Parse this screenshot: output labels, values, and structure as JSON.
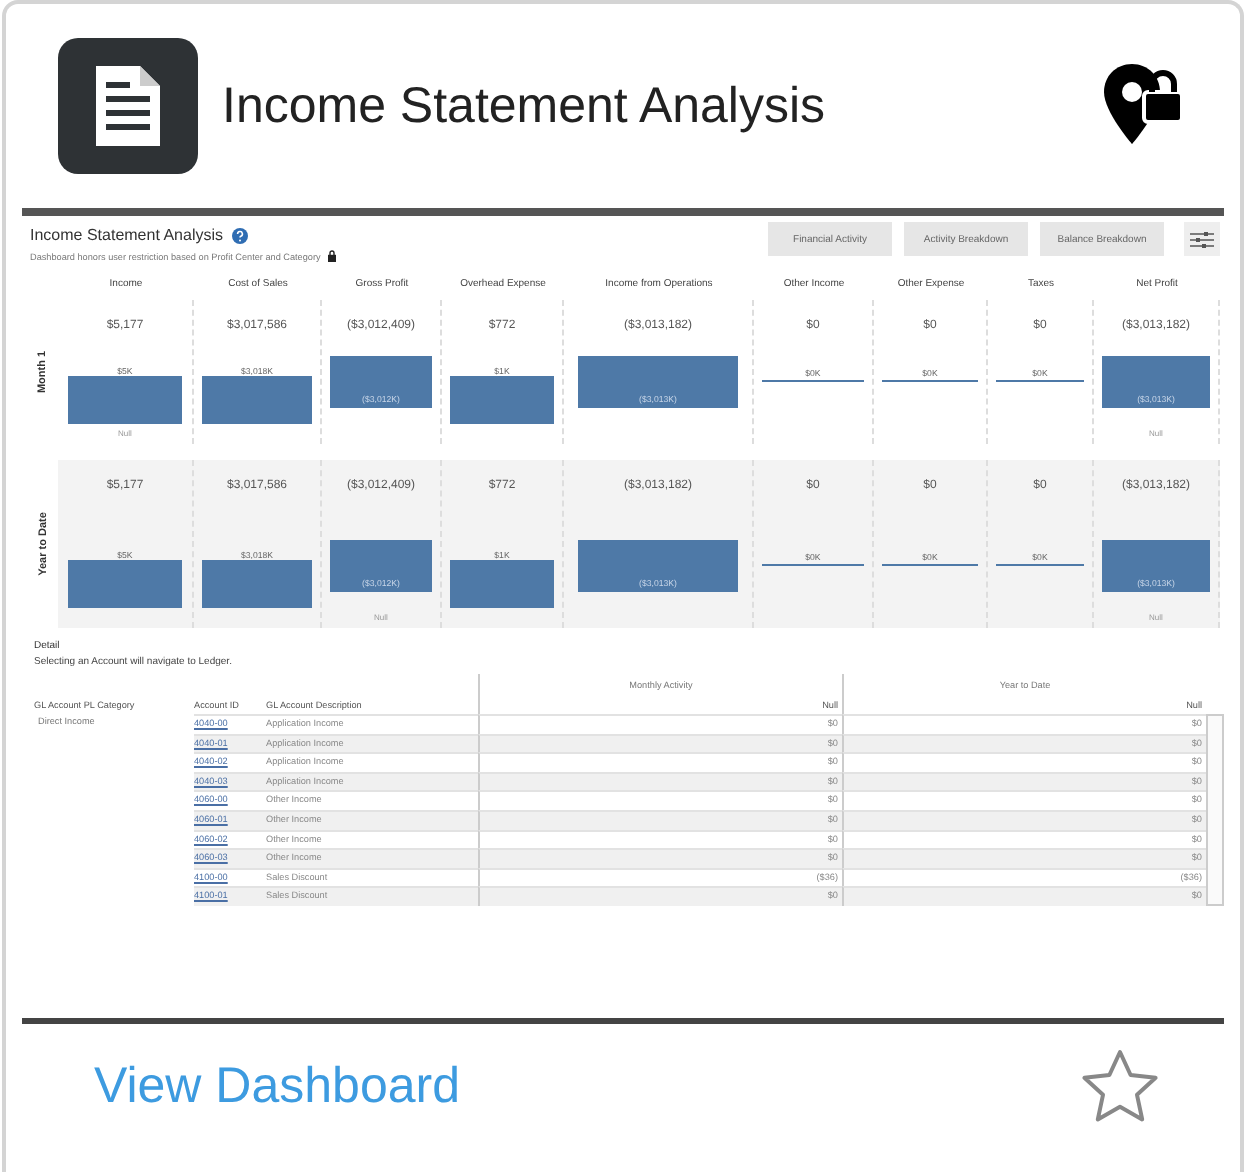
{
  "card": {
    "title": "Income Statement Analysis",
    "link": "View Dashboard",
    "favorite": false
  },
  "dashboard": {
    "title": "Income Statement Analysis",
    "subtitle": "Dashboard honors user restriction based on Profit Center and Category",
    "buttons": [
      "Financial Activity",
      "Activity Breakdown",
      "Balance Breakdown"
    ],
    "columns": [
      "Income",
      "Cost of Sales",
      "Gross Profit",
      "Overhead Expense",
      "Income from Operations",
      "Other Income",
      "Other Expense",
      "Taxes",
      "Net Profit"
    ],
    "rows": [
      {
        "label": "Month 1",
        "cells": [
          {
            "value": "$5,177",
            "bar_label": "$5K",
            "kind": "positive",
            "note": "Null"
          },
          {
            "value": "$3,017,586",
            "bar_label": "$3,018K",
            "kind": "positive"
          },
          {
            "value": "($3,012,409)",
            "bar_label": "($3,012K)",
            "kind": "negative"
          },
          {
            "value": "$772",
            "bar_label": "$1K",
            "kind": "positive"
          },
          {
            "value": "($3,013,182)",
            "bar_label": "($3,013K)",
            "kind": "negative"
          },
          {
            "value": "$0",
            "bar_label": "$0K",
            "kind": "zero"
          },
          {
            "value": "$0",
            "bar_label": "$0K",
            "kind": "zero"
          },
          {
            "value": "$0",
            "bar_label": "$0K",
            "kind": "zero"
          },
          {
            "value": "($3,013,182)",
            "bar_label": "($3,013K)",
            "kind": "negative",
            "note": "Null"
          }
        ]
      },
      {
        "label": "Year to Date",
        "cells": [
          {
            "value": "$5,177",
            "bar_label": "$5K",
            "kind": "positive"
          },
          {
            "value": "$3,017,586",
            "bar_label": "$3,018K",
            "kind": "positive"
          },
          {
            "value": "($3,012,409)",
            "bar_label": "($3,012K)",
            "kind": "negative",
            "note": "Null"
          },
          {
            "value": "$772",
            "bar_label": "$1K",
            "kind": "positive"
          },
          {
            "value": "($3,013,182)",
            "bar_label": "($3,013K)",
            "kind": "negative"
          },
          {
            "value": "$0",
            "bar_label": "$0K",
            "kind": "zero"
          },
          {
            "value": "$0",
            "bar_label": "$0K",
            "kind": "zero"
          },
          {
            "value": "$0",
            "bar_label": "$0K",
            "kind": "zero"
          },
          {
            "value": "($3,013,182)",
            "bar_label": "($3,013K)",
            "kind": "negative",
            "note": "Null"
          }
        ]
      }
    ],
    "detail": {
      "title": "Detail",
      "hint": "Selecting an Account will navigate to Ledger.",
      "column_groups": [
        "Monthly Activity",
        "Year to Date"
      ],
      "columns": [
        "GL Account PL Category",
        "Account ID",
        "GL Account Description",
        "Null",
        "Null"
      ],
      "rows": [
        {
          "category": "Direct Income",
          "account": "4040-00",
          "description": "Application Income",
          "monthly": "$0",
          "ytd": "$0"
        },
        {
          "account": "4040-01",
          "description": "Application Income",
          "monthly": "$0",
          "ytd": "$0"
        },
        {
          "account": "4040-02",
          "description": "Application Income",
          "monthly": "$0",
          "ytd": "$0"
        },
        {
          "account": "4040-03",
          "description": "Application Income",
          "monthly": "$0",
          "ytd": "$0"
        },
        {
          "account": "4060-00",
          "description": "Other Income",
          "monthly": "$0",
          "ytd": "$0"
        },
        {
          "account": "4060-01",
          "description": "Other Income",
          "monthly": "$0",
          "ytd": "$0"
        },
        {
          "account": "4060-02",
          "description": "Other Income",
          "monthly": "$0",
          "ytd": "$0"
        },
        {
          "account": "4060-03",
          "description": "Other Income",
          "monthly": "$0",
          "ytd": "$0"
        },
        {
          "account": "4100-00",
          "description": "Sales Discount",
          "monthly": "($36)",
          "ytd": "($36)"
        },
        {
          "account": "4100-01",
          "description": "Sales Discount",
          "monthly": "$0",
          "ytd": "$0"
        }
      ]
    }
  }
}
